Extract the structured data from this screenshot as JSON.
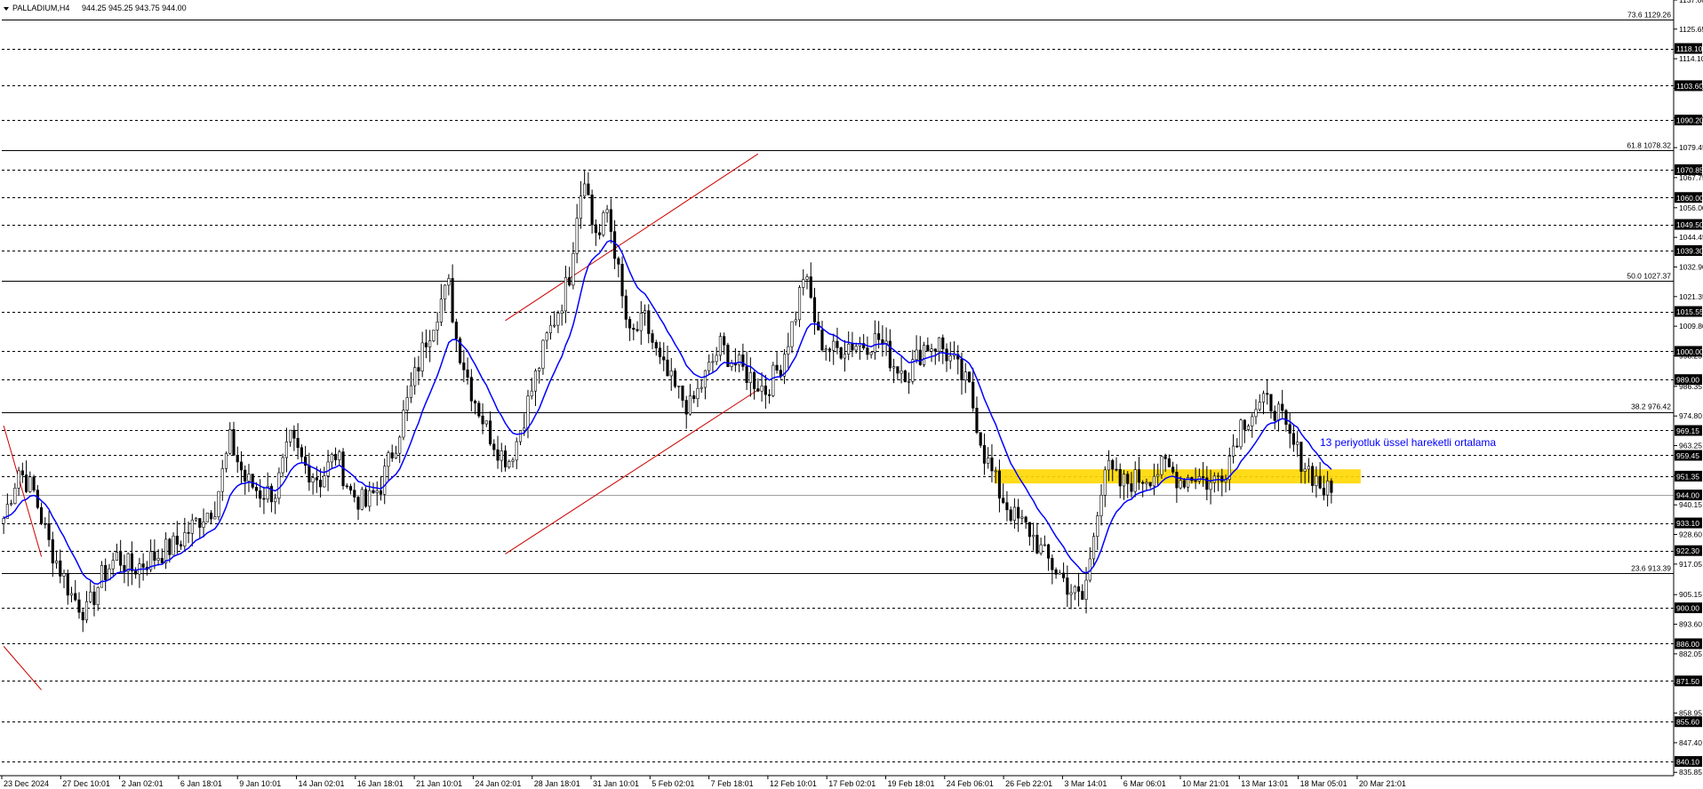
{
  "header": {
    "symbol": "PALLADIUM,H4",
    "ohlc": "944.25 945.25 943.75 944.00"
  },
  "annotation": {
    "ema_label": "13 periyotluk üssel hareketli ortalama"
  },
  "chart_data": {
    "type": "candlestick",
    "timeframe": "H4",
    "symbol": "PALLADIUM",
    "ylim": [
      834.55,
      1137.0
    ],
    "grid": false,
    "colors": {
      "candles": "#000000",
      "ema": "#0000ff",
      "channel": "#cc0000",
      "zone": "#ffd700",
      "levels": "#000000",
      "ema_label": "#0000ff"
    },
    "x_ticks": [
      "23 Dec 2024",
      "27 Dec 10:01",
      "2 Jan 02:01",
      "6 Jan 18:01",
      "9 Jan 10:01",
      "14 Jan 02:01",
      "16 Jan 18:01",
      "21 Jan 10:01",
      "24 Jan 02:01",
      "28 Jan 18:01",
      "31 Jan 10:01",
      "5 Feb 02:01",
      "7 Feb 18:01",
      "12 Feb 10:01",
      "17 Feb 02:01",
      "19 Feb 18:01",
      "24 Feb 06:01",
      "26 Feb 22:01",
      "3 Mar 14:01",
      "6 Mar 06:01",
      "10 Mar 21:01",
      "13 Mar 13:01",
      "18 Mar 05:01",
      "20 Mar 21:01"
    ],
    "y_ticks": [
      "1137.00",
      "1125.65",
      "1114.10",
      "1102.55",
      "1091.00",
      "1079.45",
      "1067.75",
      "1056.00",
      "1044.45",
      "1032.90",
      "1021.35",
      "1009.80",
      "998.25",
      "986.35",
      "974.80",
      "963.25",
      "951.70",
      "940.15",
      "928.60",
      "917.05",
      "905.15",
      "893.60",
      "882.05",
      "870.50",
      "858.95",
      "847.40",
      "835.85"
    ],
    "horizontal_levels": [
      {
        "value": 1118.1,
        "label": "1118.10"
      },
      {
        "value": 1103.6,
        "label": "1103.60"
      },
      {
        "value": 1090.2,
        "label": "1090.20"
      },
      {
        "value": 1070.85,
        "label": "1070.85"
      },
      {
        "value": 1060.0,
        "label": "1060.00"
      },
      {
        "value": 1049.5,
        "label": "1049.50"
      },
      {
        "value": 1039.3,
        "label": "1039.30"
      },
      {
        "value": 1015.55,
        "label": "1015.55"
      },
      {
        "value": 1000.0,
        "label": "1000.00"
      },
      {
        "value": 989.0,
        "label": "989.00"
      },
      {
        "value": 969.15,
        "label": "969.15"
      },
      {
        "value": 959.45,
        "label": "959.45"
      },
      {
        "value": 951.35,
        "label": "951.35"
      },
      {
        "value": 933.1,
        "label": "933.10"
      },
      {
        "value": 922.3,
        "label": "922.30"
      },
      {
        "value": 900.0,
        "label": "900.00"
      },
      {
        "value": 886.0,
        "label": "886.00"
      },
      {
        "value": 871.5,
        "label": "871.50"
      },
      {
        "value": 855.6,
        "label": "855.60"
      },
      {
        "value": 840.1,
        "label": "840.10"
      }
    ],
    "current_price": {
      "value": 944.0,
      "label": "944.00"
    },
    "fibonacci": [
      {
        "value": 1129.26,
        "label": "73.6 1129.26"
      },
      {
        "value": 1078.32,
        "label": "61.8 1078.32"
      },
      {
        "value": 1027.37,
        "label": "50.0 1027.37"
      },
      {
        "value": 976.42,
        "label": "38.2 976.42"
      },
      {
        "value": 913.39,
        "label": "23.6 913.39"
      }
    ],
    "zone": {
      "from": 948.5,
      "to": 954.0,
      "start_label": "3 Mar 14:01",
      "end_bar": 348
    },
    "channel": [
      {
        "bar_from": 133,
        "y_from": 1012,
        "bar_to": 200,
        "y_to": 1077
      },
      {
        "bar_from": 133,
        "y_from": 921,
        "bar_to": 200,
        "y_to": 985
      },
      {
        "bar_from": 0,
        "y_from": 971,
        "bar_to": 10,
        "y_to": 920
      },
      {
        "bar_from": 0,
        "y_from": 885,
        "bar_to": 10,
        "y_to": 868
      }
    ],
    "path_anchors": [
      [
        0,
        935
      ],
      [
        4,
        954
      ],
      [
        8,
        945
      ],
      [
        12,
        925
      ],
      [
        18,
        905
      ],
      [
        22,
        898
      ],
      [
        26,
        912
      ],
      [
        30,
        920
      ],
      [
        34,
        915
      ],
      [
        40,
        920
      ],
      [
        46,
        925
      ],
      [
        52,
        935
      ],
      [
        56,
        940
      ],
      [
        60,
        965
      ],
      [
        64,
        950
      ],
      [
        68,
        945
      ],
      [
        72,
        945
      ],
      [
        76,
        965
      ],
      [
        80,
        955
      ],
      [
        84,
        950
      ],
      [
        88,
        960
      ],
      [
        92,
        945
      ],
      [
        96,
        940
      ],
      [
        100,
        948
      ],
      [
        104,
        965
      ],
      [
        108,
        985
      ],
      [
        112,
        1005
      ],
      [
        116,
        1020
      ],
      [
        118,
        1025
      ],
      [
        120,
        1005
      ],
      [
        124,
        985
      ],
      [
        128,
        970
      ],
      [
        132,
        960
      ],
      [
        134,
        958
      ],
      [
        136,
        965
      ],
      [
        140,
        985
      ],
      [
        144,
        1005
      ],
      [
        148,
        1020
      ],
      [
        150,
        1030
      ],
      [
        152,
        1055
      ],
      [
        154,
        1070
      ],
      [
        156,
        1050
      ],
      [
        158,
        1045
      ],
      [
        160,
        1055
      ],
      [
        162,
        1040
      ],
      [
        164,
        1020
      ],
      [
        166,
        1005
      ],
      [
        170,
        1012
      ],
      [
        174,
        995
      ],
      [
        178,
        985
      ],
      [
        182,
        978
      ],
      [
        186,
        990
      ],
      [
        190,
        1002
      ],
      [
        194,
        995
      ],
      [
        198,
        990
      ],
      [
        202,
        985
      ],
      [
        206,
        995
      ],
      [
        210,
        1015
      ],
      [
        212,
        1030
      ],
      [
        214,
        1020
      ],
      [
        216,
        1005
      ],
      [
        220,
        1000
      ],
      [
        224,
        1003
      ],
      [
        228,
        1003
      ],
      [
        232,
        1005
      ],
      [
        236,
        995
      ],
      [
        240,
        992
      ],
      [
        244,
        1002
      ],
      [
        248,
        1003
      ],
      [
        252,
        995
      ],
      [
        256,
        985
      ],
      [
        260,
        960
      ],
      [
        264,
        945
      ],
      [
        268,
        935
      ],
      [
        272,
        930
      ],
      [
        276,
        920
      ],
      [
        280,
        913
      ],
      [
        284,
        905
      ],
      [
        286,
        903
      ],
      [
        288,
        918
      ],
      [
        290,
        940
      ],
      [
        292,
        955
      ],
      [
        296,
        948
      ],
      [
        300,
        950
      ],
      [
        304,
        952
      ],
      [
        308,
        955
      ],
      [
        312,
        950
      ],
      [
        316,
        952
      ],
      [
        320,
        948
      ],
      [
        324,
        955
      ],
      [
        328,
        972
      ],
      [
        332,
        978
      ],
      [
        336,
        980
      ],
      [
        338,
        976
      ],
      [
        340,
        968
      ],
      [
        344,
        958
      ],
      [
        348,
        950
      ],
      [
        350,
        946
      ],
      [
        352,
        944
      ]
    ],
    "ema_period": 13,
    "bars": 353
  }
}
